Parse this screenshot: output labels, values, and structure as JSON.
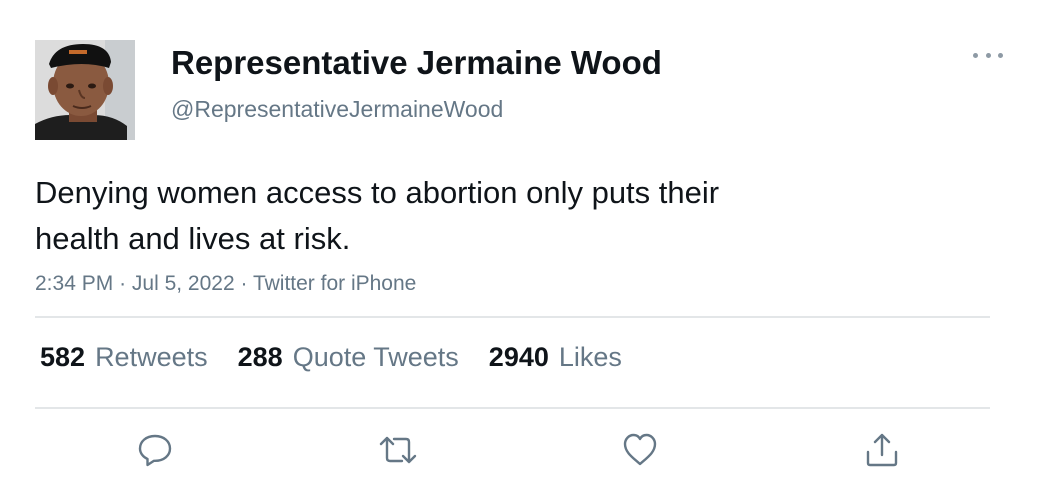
{
  "author": {
    "name": "Representative Jermaine Wood",
    "handle": "@RepresentativeJermaineWood"
  },
  "tweet": {
    "text_line1": "Denying women access to abortion only puts their",
    "text_line2": "health and lives at risk.",
    "time": "2:34 PM",
    "separator": "·",
    "date": "Jul 5, 2022",
    "source": "Twitter for iPhone"
  },
  "stats": {
    "retweets_count": "582",
    "retweets_label": "Retweets",
    "quote_count": "288",
    "quote_label": "Quote Tweets",
    "likes_count": "2940",
    "likes_label": "Likes"
  },
  "icons": {
    "more": "more-options-icon",
    "reply": "reply-icon",
    "retweet": "retweet-icon",
    "like": "like-icon",
    "share": "share-icon"
  },
  "colors": {
    "text": "#0f1419",
    "secondary": "#657786",
    "icon": "#657786",
    "divider": "#e3e6e8"
  }
}
